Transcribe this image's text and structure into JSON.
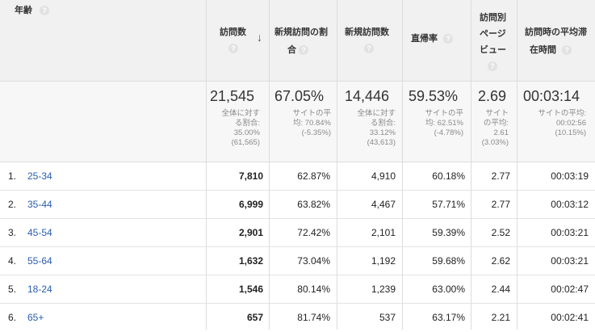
{
  "header": {
    "age": "年齢",
    "visits": "訪問数",
    "new_visit_rate_1": "新規訪問の割",
    "new_visit_rate_2": "合",
    "new_visits": "新規訪問数",
    "bounce_rate": "直帰率",
    "pages_per_visit_1": "訪問別",
    "pages_per_visit_2": "ページ",
    "pages_per_visit_3": "ビュー",
    "avg_duration_1": "訪問時の平均滞",
    "avg_duration_2": "在時間",
    "help": "?",
    "sort_icon": "arrow-down-icon"
  },
  "summary": {
    "visits": "21,545",
    "visits_sub": [
      "全体に対す",
      "る割合:",
      "35.00%",
      "(61,565)"
    ],
    "new_rate": "67.05%",
    "new_rate_sub": [
      "サイトの平",
      "均: 70.84%",
      "(-5.35%)"
    ],
    "new_visits": "14,446",
    "new_visits_sub": [
      "全体に対す",
      "る割合:",
      "33.12%",
      "(43,613)"
    ],
    "bounce": "59.53%",
    "bounce_sub": [
      "サイトの平",
      "均: 62.51%",
      "(-4.78%)"
    ],
    "pages": "2.69",
    "pages_sub": [
      "サイト",
      "の平均:",
      "2.61",
      "(3.03%)"
    ],
    "duration": "00:03:14",
    "duration_sub": [
      "サイトの平均:",
      "00:02:56",
      "(10.15%)"
    ]
  },
  "rows": [
    {
      "idx": "1.",
      "age": "25-34",
      "visits": "7,810",
      "new_rate": "62.87%",
      "new_visits": "4,910",
      "bounce": "60.18%",
      "pages": "2.77",
      "duration": "00:03:19"
    },
    {
      "idx": "2.",
      "age": "35-44",
      "visits": "6,999",
      "new_rate": "63.82%",
      "new_visits": "4,467",
      "bounce": "57.71%",
      "pages": "2.77",
      "duration": "00:03:12"
    },
    {
      "idx": "3.",
      "age": "45-54",
      "visits": "2,901",
      "new_rate": "72.42%",
      "new_visits": "2,101",
      "bounce": "59.39%",
      "pages": "2.52",
      "duration": "00:03:21"
    },
    {
      "idx": "4.",
      "age": "55-64",
      "visits": "1,632",
      "new_rate": "73.04%",
      "new_visits": "1,192",
      "bounce": "59.68%",
      "pages": "2.62",
      "duration": "00:03:21"
    },
    {
      "idx": "5.",
      "age": "18-24",
      "visits": "1,546",
      "new_rate": "80.14%",
      "new_visits": "1,239",
      "bounce": "63.00%",
      "pages": "2.44",
      "duration": "00:02:47"
    },
    {
      "idx": "6.",
      "age": "65+",
      "visits": "657",
      "new_rate": "81.74%",
      "new_visits": "537",
      "bounce": "63.17%",
      "pages": "2.21",
      "duration": "00:02:41"
    }
  ]
}
